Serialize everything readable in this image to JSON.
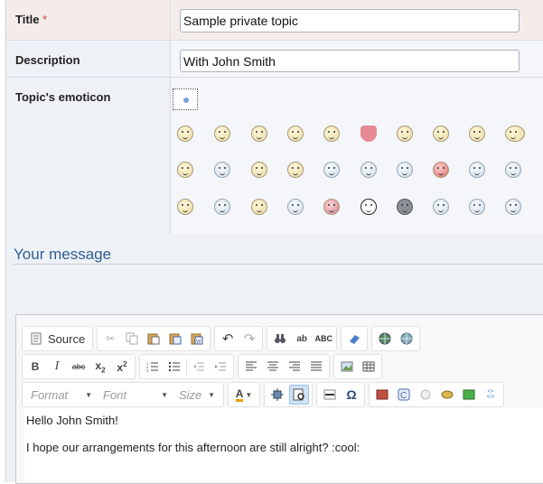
{
  "form": {
    "title_label": "Title",
    "required_mark": "*",
    "title_value": "Sample private topic",
    "description_label": "Description",
    "description_value": "With John Smith",
    "emoticon_label": "Topic's emoticon"
  },
  "message": {
    "section_title": "Your message",
    "body": [
      "Hello John Smith!",
      "I hope our arrangements for this afternoon are still alright? :cool:"
    ]
  },
  "toolbar": {
    "source_label": "Source",
    "format_placeholder": "Format",
    "font_placeholder": "Font",
    "size_placeholder": "Size"
  },
  "colors": {
    "accent": "#2f5f94",
    "required": "#d04040"
  }
}
